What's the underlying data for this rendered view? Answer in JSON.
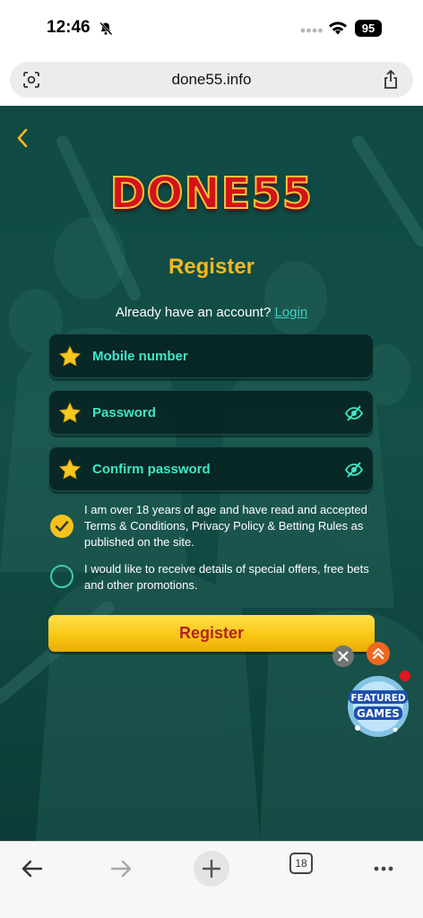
{
  "status_bar": {
    "time": "12:46",
    "battery": "95"
  },
  "browser": {
    "url": "done55.info",
    "tab_count": "18"
  },
  "page": {
    "logo": "DONE55",
    "title": "Register",
    "login_prompt": "Already have an account?",
    "login_link": "Login",
    "fields": {
      "mobile": "Mobile number",
      "password": "Password",
      "confirm_password": "Confirm password"
    },
    "checkboxes": {
      "age_text": "I am over 18 years of age and have read and accepted Terms & Conditions, Privacy Policy & Betting Rules as published on the site.",
      "age_checked": true,
      "promo_text": "I would like to receive details of special offers, free bets and other promotions.",
      "promo_checked": false
    },
    "register_button": "Register",
    "featured": {
      "line1": "FEATURED",
      "line2": "GAMES"
    }
  },
  "colors": {
    "background": "#134f48",
    "accent_gold": "#f5b81c",
    "field_label": "#3ee6c7",
    "button_text": "#b1231c",
    "logo_red": "#d4121a"
  },
  "icons": [
    "bell-slash-icon",
    "signal-icon",
    "wifi-icon",
    "lens-icon",
    "share-icon",
    "back-chevron-icon",
    "star-icon",
    "eye-slash-icon",
    "check-icon",
    "close-icon",
    "chevrons-up-icon",
    "back-arrow-icon",
    "forward-arrow-icon",
    "plus-icon",
    "more-icon"
  ]
}
